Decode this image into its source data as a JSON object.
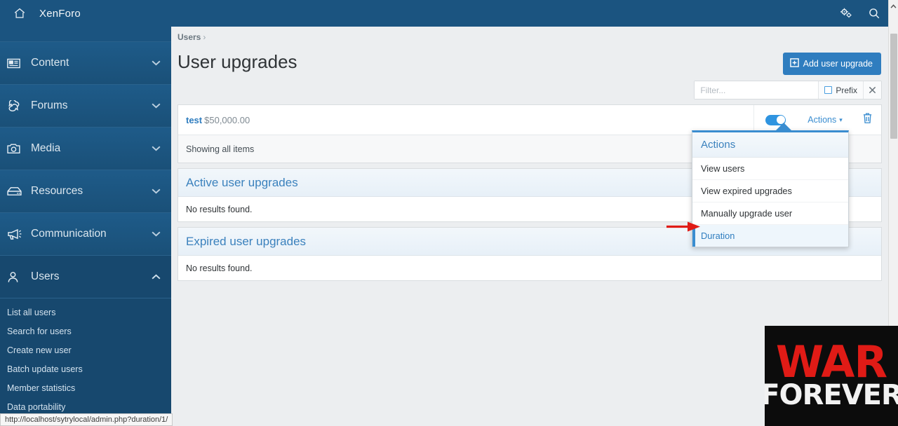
{
  "topbar": {
    "home_icon": "home-icon",
    "brand": "XenForo",
    "settings_icon": "cogs-icon",
    "search_icon": "search-icon"
  },
  "sidebar": {
    "items": [
      {
        "label": "Content",
        "icon": "content-icon",
        "chevron": "chevron-down",
        "expanded": false
      },
      {
        "label": "Forums",
        "icon": "forums-icon",
        "chevron": "chevron-down",
        "expanded": false
      },
      {
        "label": "Media",
        "icon": "media-icon",
        "chevron": "chevron-down",
        "expanded": false
      },
      {
        "label": "Resources",
        "icon": "resources-icon",
        "chevron": "chevron-down",
        "expanded": false
      },
      {
        "label": "Communication",
        "icon": "communication-icon",
        "chevron": "chevron-down",
        "expanded": false
      },
      {
        "label": "Users",
        "icon": "users-icon",
        "chevron": "chevron-up",
        "expanded": true
      }
    ],
    "sub_items": [
      {
        "label": "List all users"
      },
      {
        "label": "Search for users"
      },
      {
        "label": "Create new user"
      },
      {
        "label": "Batch update users"
      },
      {
        "label": "Member statistics"
      },
      {
        "label": "Data portability"
      }
    ]
  },
  "main": {
    "breadcrumb": {
      "label": "Users",
      "separator": "›"
    },
    "page_title": "User upgrades",
    "add_button": {
      "label": "Add user upgrade",
      "icon": "plus-square-icon"
    },
    "filter": {
      "placeholder": "Filter...",
      "value": "",
      "prefix_label": "Prefix",
      "prefix_checked": false,
      "clear_icon": "close-icon"
    },
    "upgrade_row": {
      "name": "test",
      "price": "$50,000.00",
      "toggle_on": true,
      "actions_label": "Actions",
      "actions_caret": "▾",
      "delete_icon": "trash-icon"
    },
    "showing_text": "Showing all items",
    "sections": [
      {
        "heading": "Active user upgrades",
        "body": "No results found."
      },
      {
        "heading": "Expired user upgrades",
        "body": "No results found."
      }
    ]
  },
  "menu": {
    "title": "Actions",
    "items": [
      {
        "label": "View users",
        "highlighted": false
      },
      {
        "label": "View expired upgrades",
        "highlighted": false
      },
      {
        "label": "Manually upgrade user",
        "highlighted": false
      },
      {
        "label": "Duration",
        "highlighted": true
      }
    ]
  },
  "annotation": {
    "arrow_color": "#e01b16",
    "points_to": "Duration"
  },
  "statusbar": {
    "url": "http://localhost/sytrylocal/admin.php?duration/1/"
  },
  "scrollbar": {
    "up_icon": "chevron-up-icon"
  },
  "watermark": {
    "line1": "WAR",
    "line2": "FOREVER"
  },
  "colors": {
    "brand_blue": "#1b5480",
    "accent_blue": "#2f7dbf",
    "link_blue": "#3a8dd0",
    "page_bg": "#eceef0",
    "annotation_red": "#e01b16"
  }
}
